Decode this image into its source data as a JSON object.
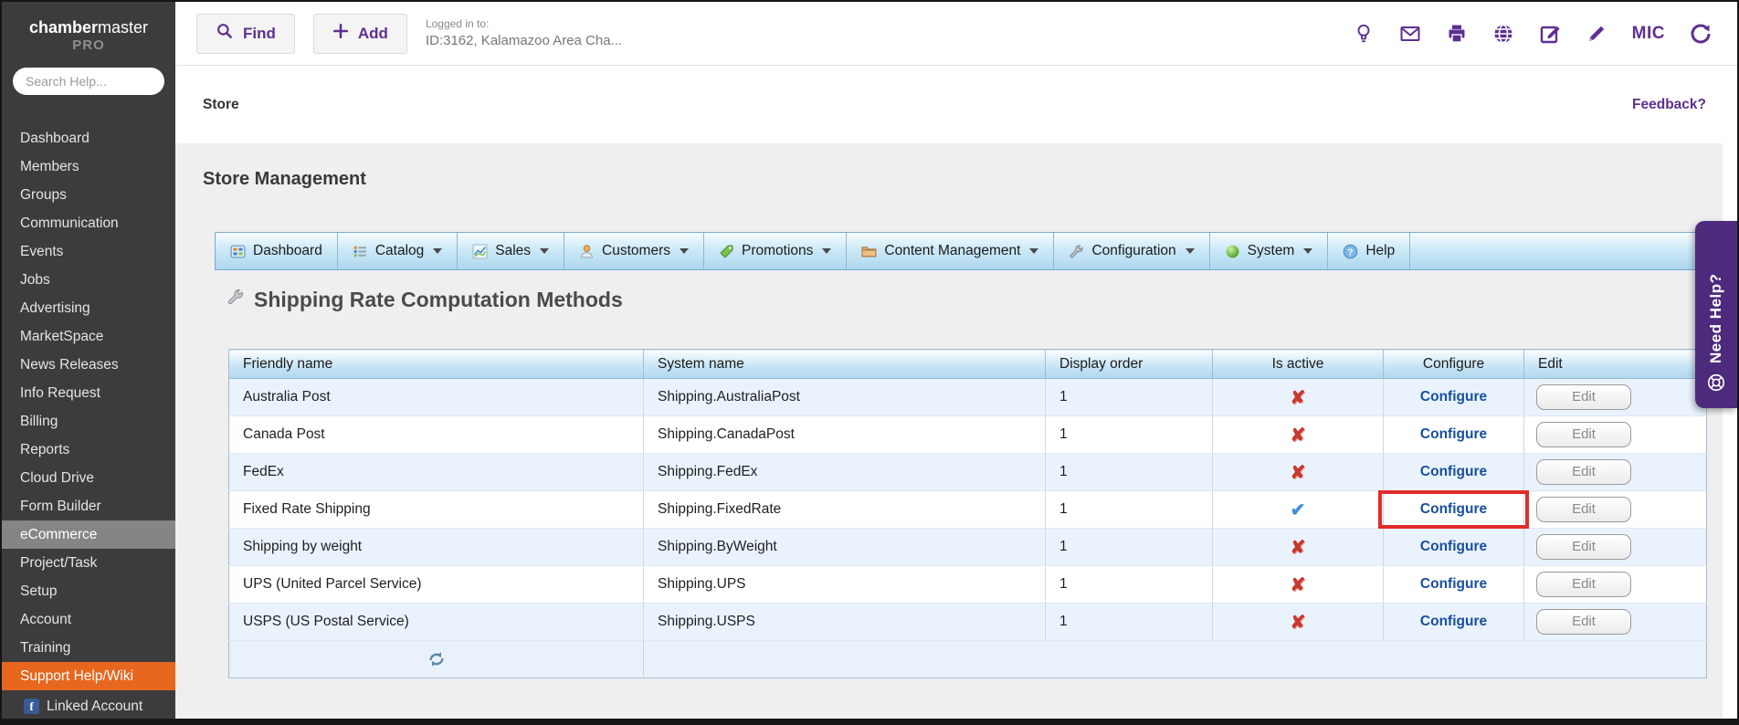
{
  "colors": {
    "accent_purple": "#5e2f91",
    "sidebar_bg": "#3c3c3c",
    "selected_item_bg": "#858585",
    "support_item_bg": "#e7671e",
    "facebook_blue": "#3a5a97",
    "need_help_bg": "#4d2a7c",
    "configure_link": "#174f9e",
    "inactive_x": "#c9382f",
    "active_check": "#4690d2",
    "highlight_frame": "#e22b2b",
    "row_alt": "#eaf3fd"
  },
  "brand": {
    "name_bold": "chamber",
    "name_light": "master",
    "tier": "PRO"
  },
  "sidebar": {
    "search_placeholder": "Search Help...",
    "items": [
      {
        "label": "Dashboard"
      },
      {
        "label": "Members"
      },
      {
        "label": "Groups"
      },
      {
        "label": "Communication"
      },
      {
        "label": "Events"
      },
      {
        "label": "Jobs"
      },
      {
        "label": "Advertising"
      },
      {
        "label": "MarketSpace"
      },
      {
        "label": "News Releases"
      },
      {
        "label": "Info Request"
      },
      {
        "label": "Billing"
      },
      {
        "label": "Reports"
      },
      {
        "label": "Cloud Drive"
      },
      {
        "label": "Form Builder"
      },
      {
        "label": "eCommerce",
        "state": "selected"
      },
      {
        "label": "Project/Task"
      },
      {
        "label": "Setup"
      },
      {
        "label": "Account"
      },
      {
        "label": "Training"
      },
      {
        "label": "Support Help/Wiki",
        "state": "support"
      }
    ],
    "linked_account": "Linked Account"
  },
  "topbar": {
    "find_label": "Find",
    "add_label": "Add",
    "logged_in_label": "Logged in to:",
    "logged_in_value": "ID:3162, Kalamazoo Area Cha...",
    "mic_label": "MIC"
  },
  "breadcrumb": {
    "section": "Store",
    "feedback_link": "Feedback?"
  },
  "store": {
    "page_title": "Store Management",
    "menu_tabs": [
      {
        "label": "Dashboard",
        "icon": "dashboard-icon",
        "caret": false
      },
      {
        "label": "Catalog",
        "icon": "catalog-icon",
        "caret": true
      },
      {
        "label": "Sales",
        "icon": "sales-icon",
        "caret": true
      },
      {
        "label": "Customers",
        "icon": "customers-icon",
        "caret": true
      },
      {
        "label": "Promotions",
        "icon": "promotions-icon",
        "caret": true
      },
      {
        "label": "Content Management",
        "icon": "folder-icon",
        "caret": true
      },
      {
        "label": "Configuration",
        "icon": "wrench-icon",
        "caret": true
      },
      {
        "label": "System",
        "icon": "system-icon",
        "caret": true
      },
      {
        "label": "Help",
        "icon": "help-icon",
        "caret": false
      }
    ],
    "section_heading": "Shipping Rate Computation Methods",
    "table": {
      "headers": [
        "Friendly name",
        "System name",
        "Display order",
        "Is active",
        "Configure",
        "Edit"
      ],
      "configure_label": "Configure",
      "edit_label": "Edit",
      "rows": [
        {
          "friendly_name": "Australia Post",
          "system_name": "Shipping.AustraliaPost",
          "display_order": "1",
          "is_active": false,
          "configure_highlighted": false
        },
        {
          "friendly_name": "Canada Post",
          "system_name": "Shipping.CanadaPost",
          "display_order": "1",
          "is_active": false,
          "configure_highlighted": false
        },
        {
          "friendly_name": "FedEx",
          "system_name": "Shipping.FedEx",
          "display_order": "1",
          "is_active": false,
          "configure_highlighted": false
        },
        {
          "friendly_name": "Fixed Rate Shipping",
          "system_name": "Shipping.FixedRate",
          "display_order": "1",
          "is_active": true,
          "configure_highlighted": true
        },
        {
          "friendly_name": "Shipping by weight",
          "system_name": "Shipping.ByWeight",
          "display_order": "1",
          "is_active": false,
          "configure_highlighted": false
        },
        {
          "friendly_name": "UPS (United Parcel Service)",
          "system_name": "Shipping.UPS",
          "display_order": "1",
          "is_active": false,
          "configure_highlighted": false
        },
        {
          "friendly_name": "USPS (US Postal Service)",
          "system_name": "Shipping.USPS",
          "display_order": "1",
          "is_active": false,
          "configure_highlighted": false
        }
      ]
    }
  },
  "need_help": {
    "label": "Need Help?"
  }
}
